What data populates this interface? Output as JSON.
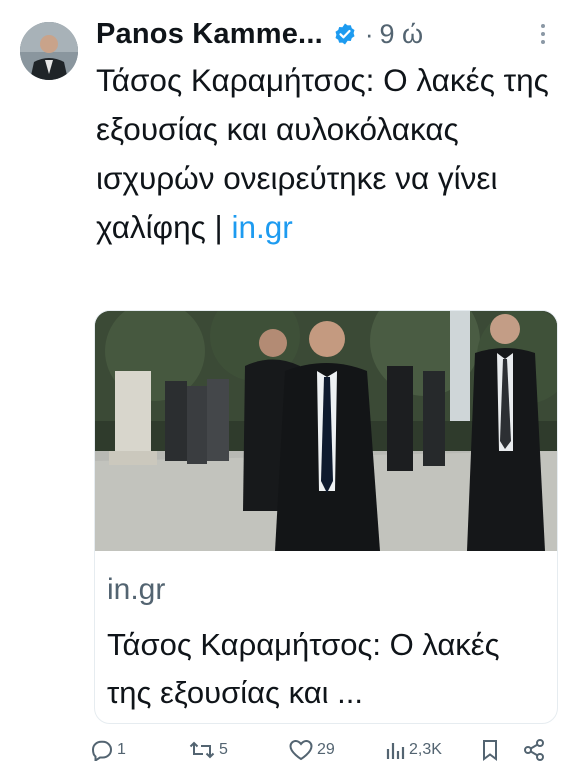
{
  "author": {
    "display_name": "Panos Kamme...",
    "verified": true,
    "separator": "·",
    "time": "9 ώ"
  },
  "tweet": {
    "text": "Τάσος Καραμήτσος: Ο λακές της εξουσίας και αυλοκόλακας ισχυρών ονειρεύτηκε να γίνει χαλίφης | ",
    "link": "in.gr"
  },
  "card": {
    "domain": "in.gr",
    "title": "Τάσος Καραμήτσος: Ο λακές της εξουσίας και ..."
  },
  "actions": {
    "replies": "1",
    "reposts": "5",
    "likes": "29",
    "views": "2,3K"
  },
  "colors": {
    "link": "#1d9bf0",
    "secondary_text": "#536471",
    "verified_badge": "#1d9bf0"
  },
  "icons": [
    "verified-badge-icon",
    "more-options-icon",
    "reply-icon",
    "repost-icon",
    "like-icon",
    "views-icon",
    "bookmark-icon",
    "share-icon"
  ]
}
